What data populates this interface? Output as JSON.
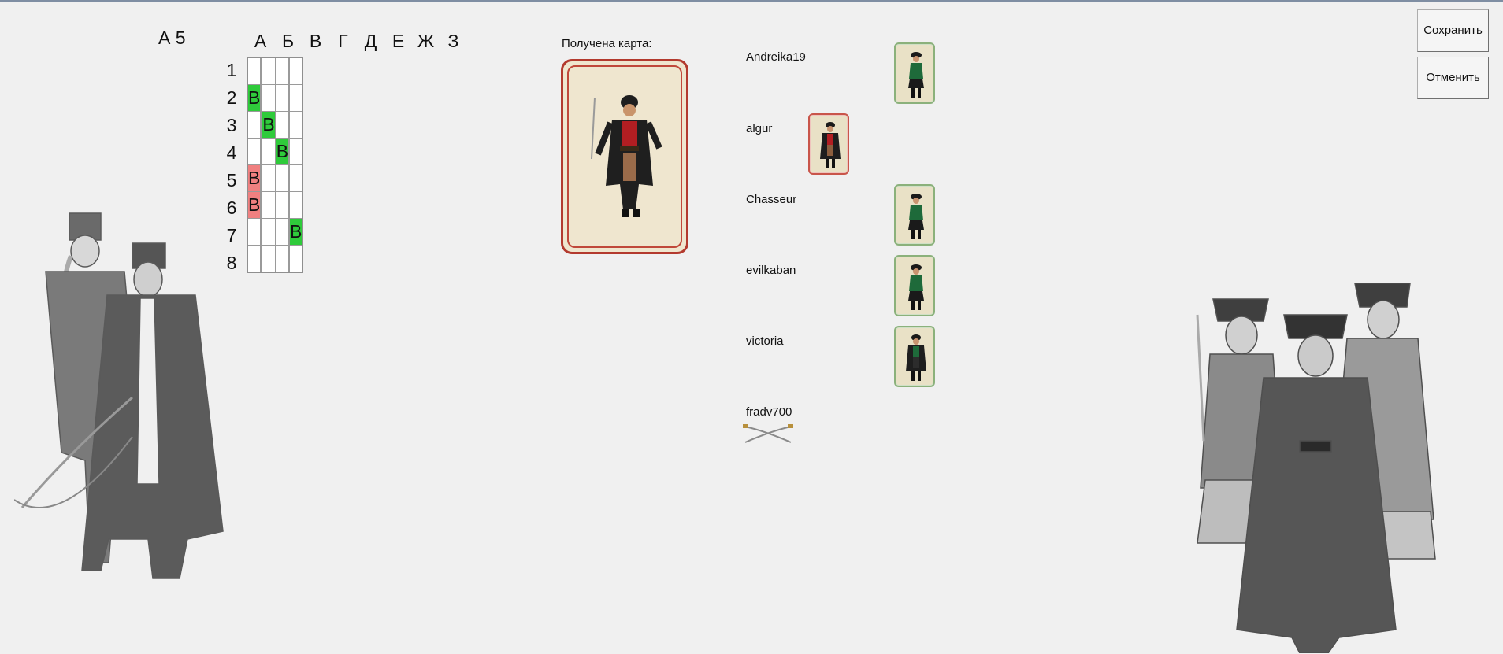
{
  "coord_label": "А 5",
  "grid": {
    "columns": [
      "А",
      "Б",
      "В",
      "Г",
      "Д",
      "Е",
      "Ж",
      "З"
    ],
    "rows": [
      "1",
      "2",
      "3",
      "4",
      "5",
      "6",
      "7",
      "8"
    ],
    "cells": [
      {
        "row": 2,
        "col": 1,
        "text": "В",
        "color": "#2fcb3b"
      },
      {
        "row": 3,
        "col": 4,
        "text": "В",
        "color": "#2fcb3b"
      },
      {
        "row": 4,
        "col": 6,
        "text": "В",
        "color": "#2fcb3b"
      },
      {
        "row": 5,
        "col": 1,
        "text": "В",
        "color": "#f08080"
      },
      {
        "row": 6,
        "col": 1,
        "text": "В",
        "color": "#f08080"
      },
      {
        "row": 7,
        "col": 8,
        "text": "В",
        "color": "#2fcb3b"
      }
    ]
  },
  "received": {
    "label": "Получена карта:",
    "card": "pirate-captain-card"
  },
  "players": [
    {
      "name": "Andreika19",
      "card": "pirate-lady-card",
      "border": "green"
    },
    {
      "name": "algur",
      "card": "pirate-captain-card",
      "border": "red"
    },
    {
      "name": "Chasseur",
      "card": "pirate-lady-card",
      "border": "green"
    },
    {
      "name": "evilkaban",
      "card": "pirate-lady-card",
      "border": "green"
    },
    {
      "name": "victoria",
      "card": "pirate-captain-card",
      "border": "green"
    },
    {
      "name": "fradv700",
      "card": "crossed-sabers-icon",
      "border": "none"
    }
  ],
  "buttons": {
    "save": "Сохранить",
    "cancel": "Отменить"
  },
  "colors": {
    "hit": "#2fcb3b",
    "miss": "#f08080",
    "card_red_border": "#b33a2e",
    "card_green_border": "#8bb17b"
  }
}
